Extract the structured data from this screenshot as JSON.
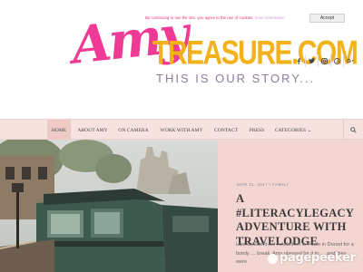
{
  "cookie_bar": {
    "text": "By continuing to use the site, you agree to the use of cookies.",
    "more_link": "more information",
    "accept_label": "Accept"
  },
  "logo": {
    "script": "Amy",
    "brand": "TREASURE.COM",
    "tagline": "THIS IS OUR STORY...",
    "colors": {
      "script": "#ef3b96",
      "brand": "#f2b21c",
      "tagline": "#8e7b9c"
    }
  },
  "social": [
    "facebook-icon",
    "twitter-icon",
    "instagram-icon",
    "pinterest-icon",
    "googleplus-icon"
  ],
  "nav": {
    "items": [
      {
        "label": "HOME",
        "active": true
      },
      {
        "label": "ABOUT AMY"
      },
      {
        "label": "ON CAMERA"
      },
      {
        "label": "WORK WITH AMY"
      },
      {
        "label": "CONTACT"
      },
      {
        "label": "PRESS"
      },
      {
        "label": "CATEGORIES ⌄"
      }
    ]
  },
  "post": {
    "date": "MAR 31, 2017",
    "category": "FAMILY",
    "title": "A #LITERACYLEGACY ADVENTURE WITH TRAVELODGE",
    "excerpt": "Last weekend we headed off to Poole in Dorset for a family … break. Amy planned for it to … and they were"
  },
  "watermark": "pagepeeker",
  "colors": {
    "nav_bg": "#f6e3e0",
    "post_bg": "#f3d6d1",
    "accent": "#e8307e"
  }
}
